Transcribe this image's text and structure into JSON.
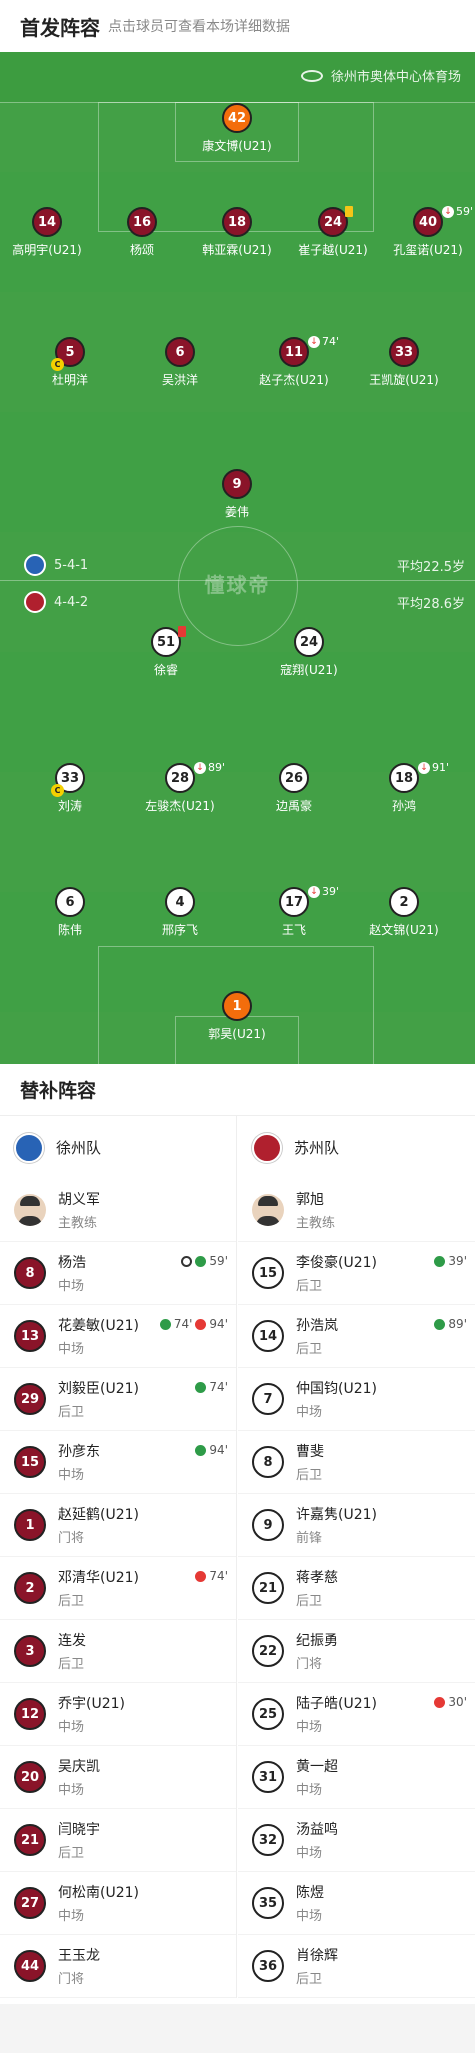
{
  "header": {
    "title": "首发阵容",
    "subtitle": "点击球员可查看本场详细数据"
  },
  "venue": "徐州市奥体中心体育场",
  "watermark": "懂球帝",
  "home": {
    "formation": "5-4-1",
    "avg_age": "平均22.5岁",
    "color": "#8a1429"
  },
  "away": {
    "formation": "4-4-2",
    "avg_age": "平均28.6岁",
    "color": "#ffffff"
  },
  "home_players": [
    {
      "num": "42",
      "name": "康文博(U21)",
      "type": "gk"
    },
    {
      "num": "14",
      "name": "高明宇(U21)"
    },
    {
      "num": "16",
      "name": "杨颂"
    },
    {
      "num": "18",
      "name": "韩亚霖(U21)"
    },
    {
      "num": "24",
      "name": "崔子越(U21)",
      "card": "yellow"
    },
    {
      "num": "40",
      "name": "孔玺诺(U21)",
      "event": "59'"
    },
    {
      "num": "5",
      "name": "杜明洋",
      "captain": "C"
    },
    {
      "num": "6",
      "name": "吴洪洋"
    },
    {
      "num": "11",
      "name": "赵子杰(U21)",
      "event": "74'"
    },
    {
      "num": "33",
      "name": "王凯旋(U21)"
    },
    {
      "num": "9",
      "name": "姜伟"
    }
  ],
  "away_players": [
    {
      "num": "51",
      "name": "徐睿",
      "card": "red"
    },
    {
      "num": "24",
      "name": "寇翔(U21)"
    },
    {
      "num": "33",
      "name": "刘涛",
      "captain": "C"
    },
    {
      "num": "28",
      "name": "左骏杰(U21)",
      "event": "89'"
    },
    {
      "num": "26",
      "name": "边禹豪"
    },
    {
      "num": "18",
      "name": "孙鸿",
      "event": "91'"
    },
    {
      "num": "6",
      "name": "陈伟"
    },
    {
      "num": "4",
      "name": "邢序飞"
    },
    {
      "num": "17",
      "name": "王飞",
      "event": "39'"
    },
    {
      "num": "2",
      "name": "赵文锦(U21)"
    },
    {
      "num": "1",
      "name": "郭昊(U21)",
      "type": "gk"
    }
  ],
  "subs": {
    "title": "替补阵容",
    "home_team": "徐州队",
    "away_team": "苏州队",
    "home_coach": {
      "name": "胡义军",
      "role": "主教练"
    },
    "away_coach": {
      "name": "郭旭",
      "role": "主教练"
    },
    "home_list": [
      {
        "num": "8",
        "name": "杨浩",
        "pos": "中场",
        "ev": "59'",
        "ball": true
      },
      {
        "num": "13",
        "name": "花姜敏(U21)",
        "pos": "中场",
        "ev": "74'",
        "ev2": "94'"
      },
      {
        "num": "29",
        "name": "刘毅臣(U21)",
        "pos": "后卫",
        "ev": "74'"
      },
      {
        "num": "15",
        "name": "孙彦东",
        "pos": "中场",
        "ev": "94'"
      },
      {
        "num": "1",
        "name": "赵延鹤(U21)",
        "pos": "门将"
      },
      {
        "num": "2",
        "name": "邓清华(U21)",
        "pos": "后卫",
        "ev_out": "74'"
      },
      {
        "num": "3",
        "name": "连发",
        "pos": "后卫"
      },
      {
        "num": "12",
        "name": "乔宇(U21)",
        "pos": "中场"
      },
      {
        "num": "20",
        "name": "吴庆凯",
        "pos": "中场"
      },
      {
        "num": "21",
        "name": "闫晓宇",
        "pos": "后卫"
      },
      {
        "num": "27",
        "name": "何松南(U21)",
        "pos": "中场"
      },
      {
        "num": "44",
        "name": "王玉龙",
        "pos": "门将"
      }
    ],
    "away_list": [
      {
        "num": "15",
        "name": "李俊豪(U21)",
        "pos": "后卫",
        "ev": "39'"
      },
      {
        "num": "14",
        "name": "孙浩岚",
        "pos": "后卫",
        "ev": "89'"
      },
      {
        "num": "7",
        "name": "仲国钧(U21)",
        "pos": "中场"
      },
      {
        "num": "8",
        "name": "曹斐",
        "pos": "后卫"
      },
      {
        "num": "9",
        "name": "许嘉隽(U21)",
        "pos": "前锋"
      },
      {
        "num": "21",
        "name": "蒋孝慈",
        "pos": "后卫"
      },
      {
        "num": "22",
        "name": "纪振勇",
        "pos": "门将"
      },
      {
        "num": "25",
        "name": "陆子皓(U21)",
        "pos": "中场",
        "ev_out": "30'"
      },
      {
        "num": "31",
        "name": "黄一超",
        "pos": "中场"
      },
      {
        "num": "32",
        "name": "汤益鸣",
        "pos": "中场"
      },
      {
        "num": "35",
        "name": "陈煜",
        "pos": "中场"
      },
      {
        "num": "36",
        "name": "肖徐辉",
        "pos": "后卫"
      }
    ]
  }
}
